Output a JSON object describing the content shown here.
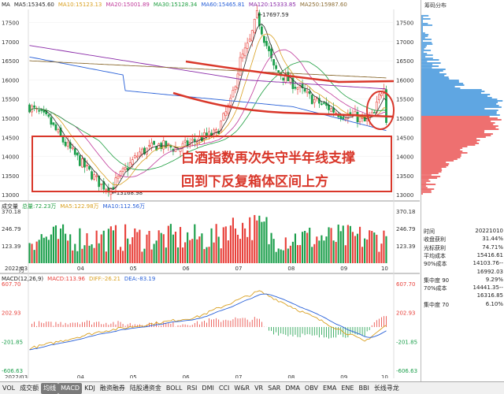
{
  "main_header": {
    "name": "MA",
    "ma5": "MA5:15345.60",
    "ma10": "MA10:15123.13",
    "ma20": "MA20:15001.89",
    "ma30": "MA30:15128.34",
    "ma60": "MA60:15465.81",
    "ma120": "MA120:15333.85",
    "ma250": "MA250:15987.60"
  },
  "price_annotations": {
    "high": "←17697.59",
    "low": "←13168.98"
  },
  "price_axis": [
    "17500",
    "17000",
    "16500",
    "16000",
    "15500",
    "15000",
    "14500",
    "14000",
    "13500",
    "13000"
  ],
  "overlay_text": {
    "line1": "白酒指数再次失守半年线支撑",
    "line2": "回到下反复箱体区间上方"
  },
  "volume_header": {
    "name": "成交量",
    "total": "总量:72.23万",
    "ma5": "MA5:122.98万",
    "ma10": "MA10:112.56万"
  },
  "volume_axis": [
    "370.18",
    "246.79",
    "123.39"
  ],
  "volume_unit": "万",
  "date_labels": [
    "2022/03",
    "04",
    "05",
    "06",
    "07",
    "08",
    "09",
    "10"
  ],
  "macd_header": {
    "name": "MACD(12,26,9)",
    "macd": "MACD:113.96",
    "diff": "DIFF:-26.21",
    "dea": "DEA:-83.19"
  },
  "macd_axis": [
    "607.70",
    "202.93",
    "-201.85",
    "-606.63"
  ],
  "sidebar": {
    "title": "筹码分布",
    "rows": [
      {
        "label": "时间",
        "value": "20221010"
      },
      {
        "label": "收盘获利",
        "value": "31.44%"
      },
      {
        "label": "光标获利",
        "value": "74.71%"
      },
      {
        "label": "平均成本",
        "value": "15416.61"
      },
      {
        "label": "90%成本",
        "value": "14103.76--"
      },
      {
        "label": "",
        "value": "16992.03"
      },
      {
        "label": "集中度 90",
        "value": "9.29%"
      },
      {
        "label": "70%成本",
        "value": "14441.35--"
      },
      {
        "label": "",
        "value": "16316.85"
      },
      {
        "label": "集中度 70",
        "value": "6.10%"
      }
    ]
  },
  "tabs": [
    "VOL",
    "成交额",
    "均线",
    "MACD",
    "KDJ",
    "融资融券",
    "陆股通资金",
    "BOLL",
    "RSI",
    "DMI",
    "CCI",
    "W&R",
    "VR",
    "SAR",
    "DMA",
    "OBV",
    "EMA",
    "ENE",
    "BBI",
    "长线寻龙"
  ],
  "active_tabs": [
    "均线",
    "MACD"
  ],
  "colors": {
    "up": "#e8403a",
    "down": "#1a9e4a",
    "ma5": "#2a2a2a",
    "ma10": "#d9a020",
    "ma20": "#c0399a",
    "ma30": "#1e9e40",
    "ma60": "#2860d8",
    "ma120": "#8a2aa8",
    "ma250": "#8a6a30",
    "annotation": "#d9372a",
    "chip_up": "#e84040",
    "chip_down": "#2a88d8"
  }
}
